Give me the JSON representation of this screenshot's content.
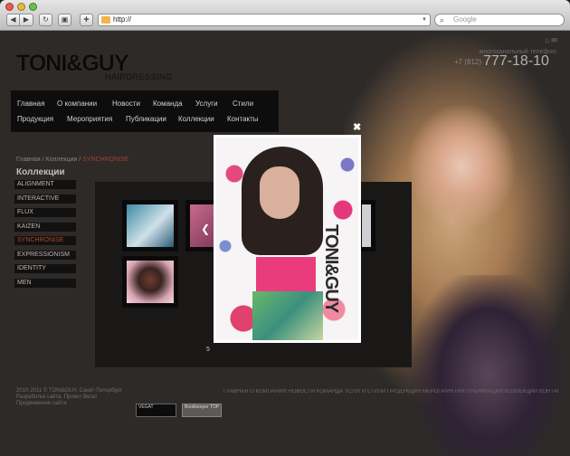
{
  "browser": {
    "address": "http://",
    "search_placeholder": "Google",
    "buttons": {
      "back": "◀",
      "forward": "▶",
      "reload": "↻",
      "snapshot": "▣",
      "add": "+"
    }
  },
  "header": {
    "logo": "TONI&GUY",
    "logo_sub": "HAIRDRESSING",
    "phone_label": "многоканальный телефон:",
    "phone_code": "+7 (812)",
    "phone_number": "777-18-10",
    "top_icons": "⌂  ✉"
  },
  "menu": [
    "Главная",
    "О компании",
    "Новости",
    "Команда",
    "Услуги",
    "Стили",
    "Продукция",
    "Мероприятия",
    "Публикации",
    "Коллекции",
    "Контакты"
  ],
  "breadcrumb": {
    "home": "Главная",
    "sep1": " / ",
    "collections": "Коллекции",
    "sep2": " / ",
    "current": "SYNCHRONISE"
  },
  "section_title": "Коллекции",
  "collections": [
    "ALIGNMENT",
    "INTERACTIVE",
    "FLUX",
    "KAIZEN",
    "SYNCHRONISE",
    "EXPRESSIONISM",
    "IDENTITY",
    "MEN"
  ],
  "lightbox": {
    "close": "✖",
    "prev": "❮",
    "counter": "5",
    "brand": "TONI&GUY"
  },
  "footer": {
    "copyright": "2010-2011 © TONI&GUY. Санкт-Петербург",
    "dev": "Разработка сайта: Проект Вегат",
    "promo": "Продвижение сайта",
    "links": "ГЛАВНАЯ  О КОМПАНИИ  НОВОСТИ  КОМАНДА  УСЛУГИ  СТИЛИ  ПРОДУКЦИЯ  МЕРОПРИЯТИЯ  ПУБЛИКАЦИИ  КОЛЛЕКЦИИ  КОНТАКТЫ",
    "badge1": "VEGAT",
    "badge2": "Bookkeeper TOP"
  },
  "colors": {
    "accent": "#b2442b",
    "menu_bg": "#0e0d0d",
    "page_bg": "#2d2a28"
  }
}
